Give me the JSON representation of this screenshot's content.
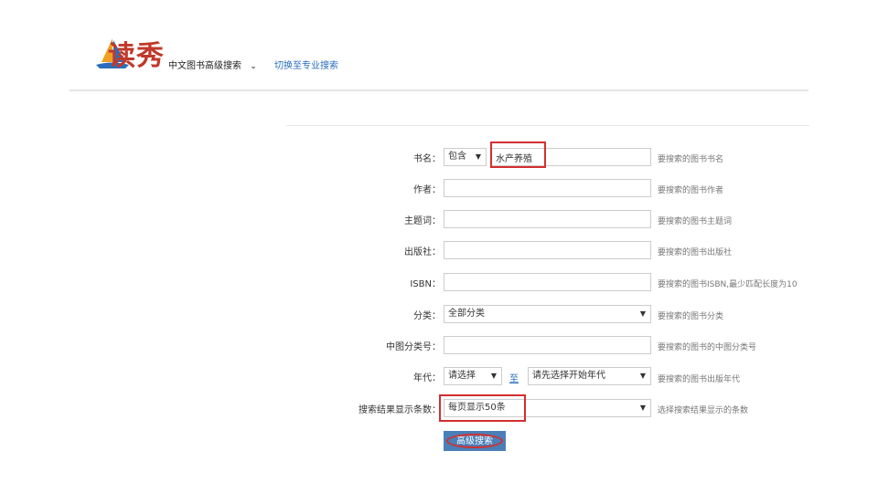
{
  "brand": {
    "logo_text": "读秀"
  },
  "header": {
    "search_mode": "中文图书高级搜索",
    "switch_link": "切换至专业搜索"
  },
  "form": {
    "title": {
      "label": "书名：",
      "match": "包含",
      "value": "水产养殖",
      "hint": "要搜索的图书书名"
    },
    "author": {
      "label": "作者：",
      "hint": "要搜索的图书作者"
    },
    "subject": {
      "label": "主题词：",
      "hint": "要搜索的图书主题词"
    },
    "publisher": {
      "label": "出版社：",
      "hint": "要搜索的图书出版社"
    },
    "isbn": {
      "label": "ISBN：",
      "hint": "要搜索的图书ISBN,最少匹配长度为10"
    },
    "category": {
      "label": "分类：",
      "value": "全部分类",
      "hint": "要搜索的图书分类"
    },
    "clc": {
      "label": "中图分类号：",
      "hint": "要搜索的图书的中图分类号"
    },
    "year": {
      "label": "年代：",
      "from": "请选择",
      "to_label": "至",
      "to": "请先选择开始年代",
      "hint": "要搜索的图书出版年代"
    },
    "per_page": {
      "label": "搜索结果显示条数：",
      "value": "每页显示50条",
      "hint": "选择搜索结果显示的条数"
    },
    "submit_label": "高级搜索"
  },
  "colors": {
    "accent_red": "#d32f2f",
    "link_blue": "#2a6ebd",
    "button_blue": "#4a7fb8"
  }
}
